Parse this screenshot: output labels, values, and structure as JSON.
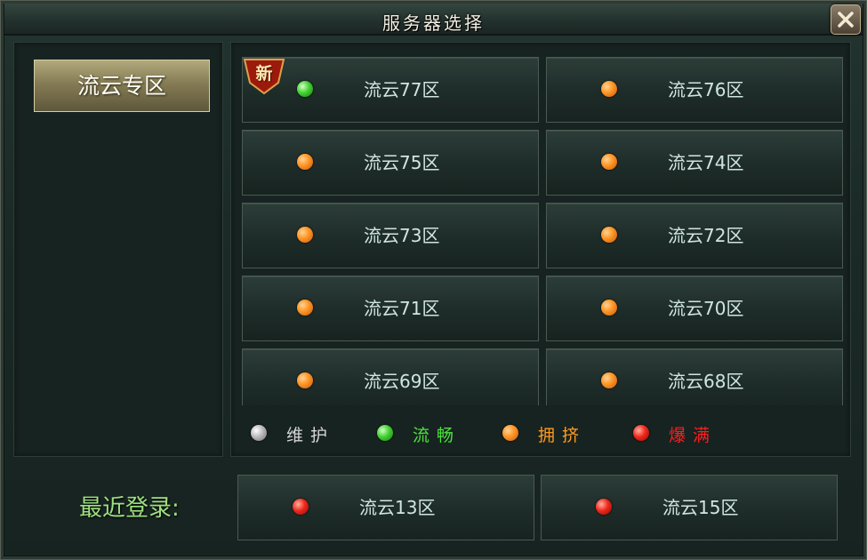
{
  "window": {
    "title": "服务器选择"
  },
  "zone_tab": {
    "label": "流云专区"
  },
  "new_badge": "新",
  "servers": [
    {
      "name": "流云77区",
      "status": "green"
    },
    {
      "name": "流云76区",
      "status": "orange"
    },
    {
      "name": "流云75区",
      "status": "orange"
    },
    {
      "name": "流云74区",
      "status": "orange"
    },
    {
      "name": "流云73区",
      "status": "orange"
    },
    {
      "name": "流云72区",
      "status": "orange"
    },
    {
      "name": "流云71区",
      "status": "orange"
    },
    {
      "name": "流云70区",
      "status": "orange"
    },
    {
      "name": "流云69区",
      "status": "orange"
    },
    {
      "name": "流云68区",
      "status": "orange"
    }
  ],
  "legend": [
    {
      "label": "维护",
      "status": "gray",
      "color": "#d6d6d6"
    },
    {
      "label": "流畅",
      "status": "green",
      "color": "#4be23a"
    },
    {
      "label": "拥挤",
      "status": "orange",
      "color": "#ff9a1f"
    },
    {
      "label": "爆满",
      "status": "red",
      "color": "#ff1e1e"
    }
  ],
  "recent": {
    "label": "最近登录:",
    "servers": [
      {
        "name": "流云13区",
        "status": "red"
      },
      {
        "name": "流云15区",
        "status": "red"
      }
    ]
  }
}
